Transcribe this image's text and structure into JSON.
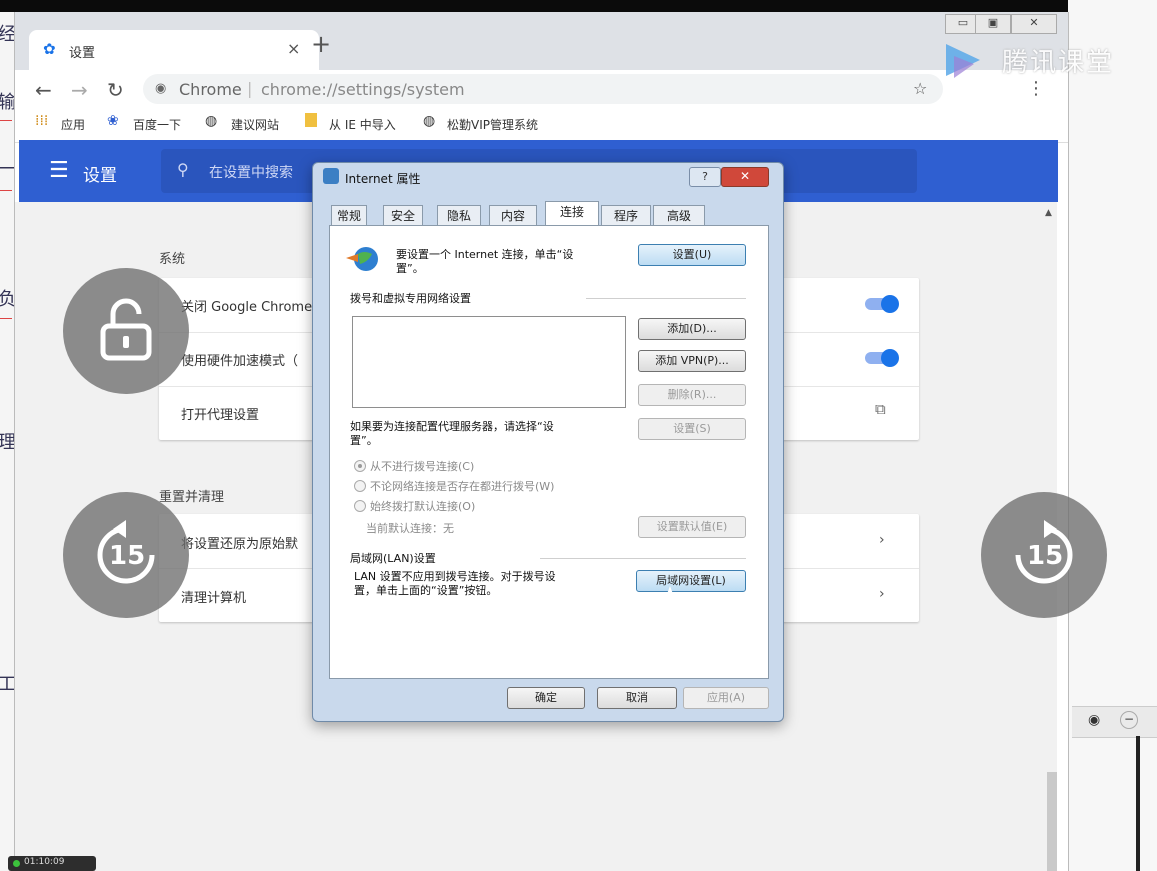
{
  "chrome": {
    "tab_title": "设置",
    "tab_close": "×",
    "new_tab": "+",
    "url_site": "Chrome",
    "url_path": "chrome://settings/system",
    "bookmarks": [
      {
        "label": "应用"
      },
      {
        "label": "百度一下"
      },
      {
        "label": "建议网站"
      },
      {
        "label": "从 IE 中导入"
      },
      {
        "label": "松勤VIP管理系统"
      }
    ]
  },
  "settings": {
    "header_title": "设置",
    "search_placeholder": "在设置中搜索",
    "system_section": "系统",
    "system_rows": [
      {
        "label": "关闭 Google Chrome"
      },
      {
        "label": "使用硬件加速模式（"
      },
      {
        "label": "打开代理设置"
      }
    ],
    "reset_section": "重置并清理",
    "reset_rows": [
      {
        "label": "将设置还原为原始默"
      },
      {
        "label": "清理计算机"
      }
    ]
  },
  "overlay": {
    "logo_text": "腾讯课堂",
    "skip_back_label": "15",
    "skip_forward_label": "15"
  },
  "dialog": {
    "title": "Internet 属性",
    "help_label": "?",
    "close_label": "✕",
    "tabs": [
      "常规",
      "安全",
      "隐私",
      "内容",
      "连接",
      "程序",
      "高级"
    ],
    "active_tab": "连接",
    "setup_text_1": "要设置一个 Internet 连接，单击“设",
    "setup_text_2": "置”。",
    "setup_button": "设置(U)",
    "dialup_group": "拨号和虚拟专用网络设置",
    "add_button": "添加(D)...",
    "add_vpn_button": "添加 VPN(P)...",
    "remove_button": "删除(R)...",
    "proxy_text_1": "如果要为连接配置代理服务器，请选择“设",
    "proxy_text_2": "置”。",
    "settings_button": "设置(S)",
    "radio_options": [
      "从不进行拨号连接(C)",
      "不论网络连接是否存在都进行拨号(W)",
      "始终拨打默认连接(O)"
    ],
    "current_default": "当前默认连接：无",
    "set_default_button": "设置默认值(E)",
    "lan_group": "局域网(LAN)设置",
    "lan_text_1": "LAN 设置不应用到拨号连接。对于拨号设",
    "lan_text_2": "置，单击上面的“设置”按钮。",
    "lan_button": "局域网设置(L)",
    "ok_button": "确定",
    "cancel_button": "取消",
    "apply_button": "应用(A)"
  },
  "player": {
    "timer": "01:10:09"
  },
  "background": {
    "left_chars": [
      "经",
      "输",
      "一",
      "负",
      "理",
      "工"
    ]
  },
  "colors": {
    "settings_blue": "#2f5fd1",
    "toggle_blue": "#1a73e8",
    "dialog_frame": "#c9d9ec",
    "close_red": "#d0483a"
  }
}
